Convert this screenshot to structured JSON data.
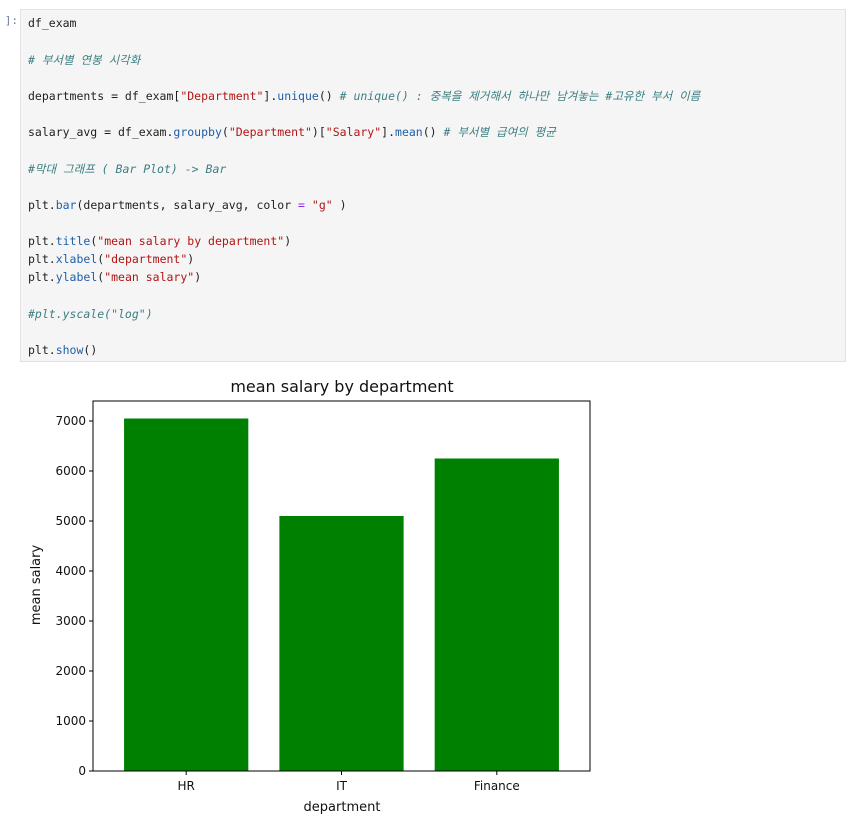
{
  "cell": {
    "prompt": "]:",
    "lines": {
      "l1": {
        "t1": "df_exam"
      },
      "l2": {
        "c1": "# 부서별 연봉 시각화"
      },
      "l3": {
        "t1": "departments = df_exam[",
        "s1": "\"Department\"",
        "t2": "].",
        "f1": "unique",
        "t3": "() ",
        "c1": "# unique() : 중복을 제거해서 하나만 남겨놓는 #고유한 부서 이름"
      },
      "l4": {
        "t1": "salary_avg = df_exam.",
        "f1": "groupby",
        "t2": "(",
        "s1": "\"Department\"",
        "t3": ")[",
        "s2": "\"Salary\"",
        "t4": "].",
        "f2": "mean",
        "t5": "() ",
        "c1": "# 부서별 급여의 평균"
      },
      "l5": {
        "c1": "#막대 그래프 ( Bar Plot) -> Bar"
      },
      "l6": {
        "t1": "plt.",
        "f1": "bar",
        "t2": "(departments, salary_avg, color ",
        "o1": "=",
        "t3": " ",
        "s1": "\"g\"",
        "t4": " )"
      },
      "l7": {
        "t1": "plt.",
        "f1": "title",
        "t2": "(",
        "s1": "\"mean salary by department\"",
        "t3": ")"
      },
      "l8": {
        "t1": "plt.",
        "f1": "xlabel",
        "t2": "(",
        "s1": "\"department\"",
        "t3": ")"
      },
      "l9": {
        "t1": "plt.",
        "f1": "ylabel",
        "t2": "(",
        "s1": "\"mean salary\"",
        "t3": ")"
      },
      "l10": {
        "c1": "#plt.yscale(\"log\")"
      },
      "l11": {
        "t1": "plt.",
        "f1": "show",
        "t2": "()"
      }
    }
  },
  "chart_data": {
    "type": "bar",
    "title": "mean salary by department",
    "xlabel": "department",
    "ylabel": "mean salary",
    "categories": [
      "HR",
      "IT",
      "Finance"
    ],
    "values": [
      7050,
      5100,
      6250
    ],
    "ylim": [
      0,
      7400
    ],
    "yticks": [
      0,
      1000,
      2000,
      3000,
      4000,
      5000,
      6000,
      7000
    ],
    "bar_color": "#008000",
    "grid": false,
    "legend": "none"
  }
}
